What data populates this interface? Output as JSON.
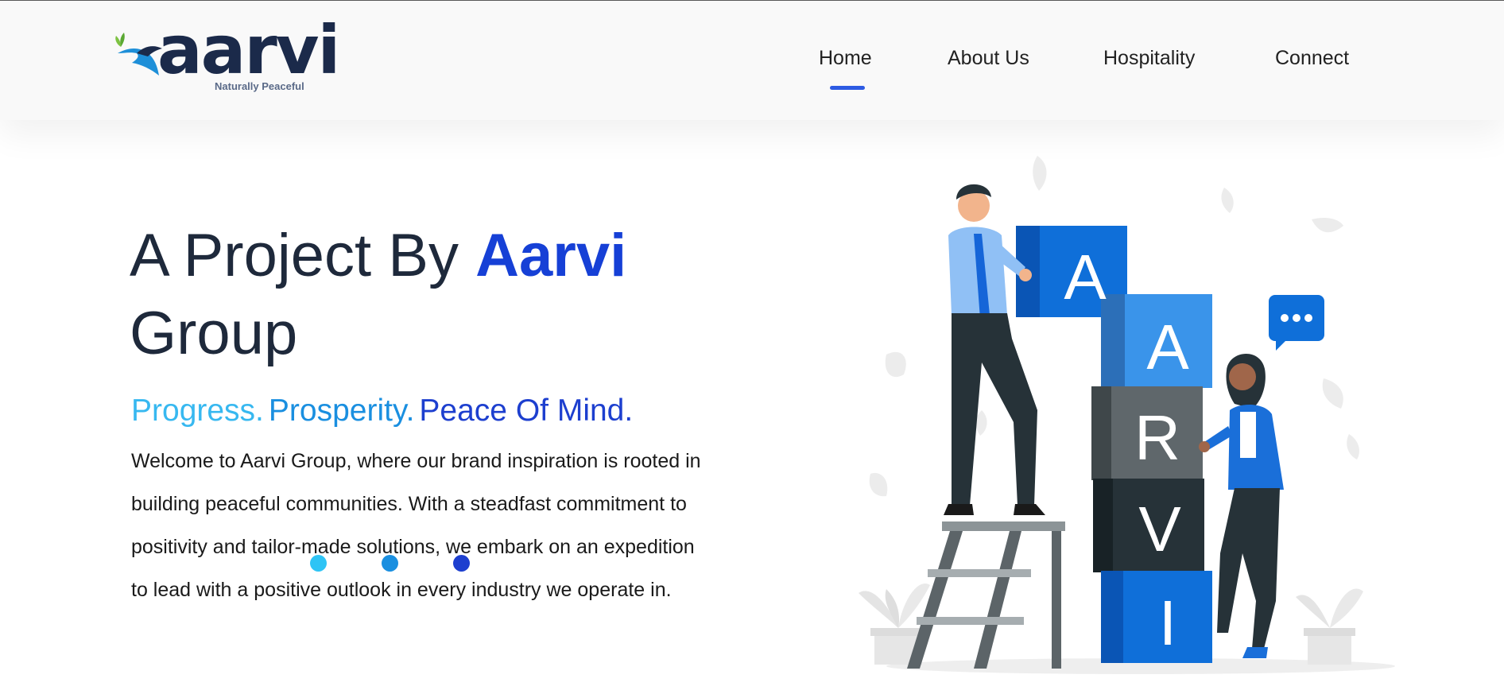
{
  "header": {
    "logo": {
      "name": "aarvi",
      "tagline": "Naturally Peaceful"
    },
    "nav": [
      {
        "label": "Home",
        "active": true
      },
      {
        "label": "About Us",
        "active": false
      },
      {
        "label": "Hospitality",
        "active": false
      },
      {
        "label": "Connect",
        "active": false
      }
    ]
  },
  "hero": {
    "title_prefix": "A Project By",
    "title_brand": "Aarvi",
    "title_suffix": "Group",
    "tagline": [
      "Progress.",
      "Prosperity.",
      "Peace Of Mind."
    ],
    "intro": "Welcome to Aarvi Group, where our brand inspiration is rooted in building peaceful communities. With a steadfast commitment to positivity and tailor-made solutions, we embark on an expedition to lead with a positive outlook in every industry we operate in.",
    "carousel_dot_count": 3
  },
  "illustration": {
    "blocks": [
      "A",
      "A",
      "R",
      "V",
      "I"
    ]
  },
  "colors": {
    "brand_blue": "#1640d6",
    "tag_light": "#37b8f0",
    "tag_mid": "#1a8fe0",
    "tag_dark": "#1d3fcf",
    "nav_active_underline": "#2d5be3",
    "text_dark": "#1e293b"
  },
  "icons": [
    "bird-logo-icon",
    "chat-bubble-icon",
    "plant-icon"
  ]
}
